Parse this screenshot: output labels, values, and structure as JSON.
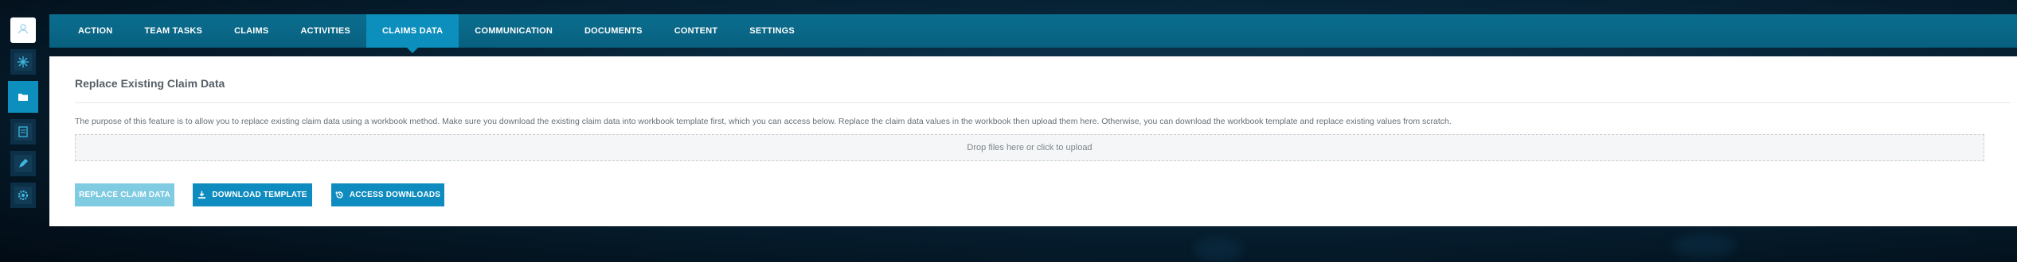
{
  "nav": {
    "tabs": [
      {
        "label": "ACTION"
      },
      {
        "label": "TEAM TASKS"
      },
      {
        "label": "CLAIMS"
      },
      {
        "label": "ACTIVITIES"
      },
      {
        "label": "CLAIMS DATA"
      },
      {
        "label": "COMMUNICATION"
      },
      {
        "label": "DOCUMENTS"
      },
      {
        "label": "CONTENT"
      },
      {
        "label": "SETTINGS"
      }
    ],
    "active_tab": "CLAIMS DATA"
  },
  "sidebar": {
    "items": [
      {
        "icon": "user-profile-icon"
      },
      {
        "icon": "network-icon"
      },
      {
        "icon": "folder-icon",
        "active": true
      },
      {
        "icon": "document-icon"
      },
      {
        "icon": "pen-icon"
      },
      {
        "icon": "gear-icon"
      }
    ]
  },
  "main": {
    "title": "Replace Existing Claim Data",
    "description": "The purpose of this feature is to allow you to replace existing claim data using a workbook method. Make sure you download the existing claim data into workbook template first, which you can access below. Replace the claim data values in the workbook then upload them here. Otherwise, you can download the workbook template and replace existing values from scratch.",
    "dropzone_text": "Drop files here or click to upload",
    "buttons": {
      "replace": "REPLACE CLAIM DATA",
      "download_template": "DOWNLOAD TEMPLATE",
      "access_downloads": "ACCESS DOWNLOADS"
    }
  },
  "colors": {
    "accent": "#0d8fbd",
    "nav_bg": "#0b6e8f",
    "disabled_button": "#7fcbe2"
  }
}
